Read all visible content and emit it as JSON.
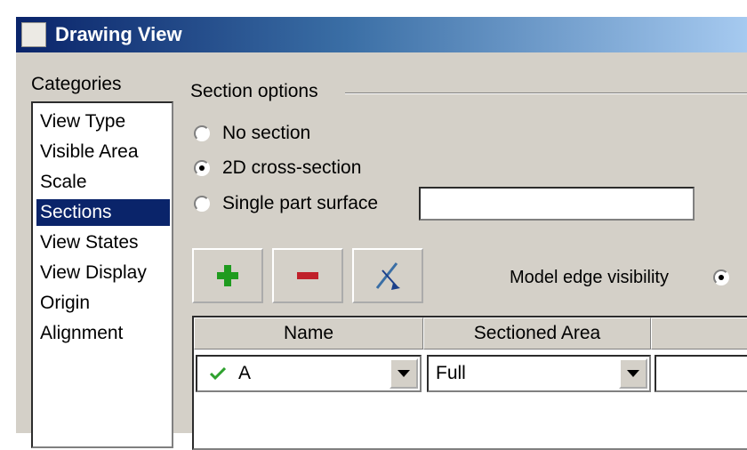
{
  "window": {
    "title": "Drawing View"
  },
  "categories": {
    "label": "Categories",
    "items": [
      {
        "label": "View Type"
      },
      {
        "label": "Visible Area"
      },
      {
        "label": "Scale"
      },
      {
        "label": "Sections",
        "selected": true
      },
      {
        "label": "View States"
      },
      {
        "label": "View Display"
      },
      {
        "label": "Origin"
      },
      {
        "label": "Alignment"
      }
    ]
  },
  "section_options": {
    "group_label": "Section options",
    "options": [
      {
        "label": "No section",
        "checked": false
      },
      {
        "label": "2D cross-section",
        "checked": true
      },
      {
        "label": "Single part surface",
        "checked": false
      }
    ],
    "single_part_value": ""
  },
  "toolbar": {
    "add_icon": "plus-icon",
    "remove_icon": "minus-icon",
    "flip_icon": "flip-arrow-icon"
  },
  "model_edge": {
    "label": "Model edge visibility",
    "checked": true
  },
  "table": {
    "columns": [
      "Name",
      "Sectioned Area",
      ""
    ],
    "rows": [
      {
        "status_icon": "checkmark-icon",
        "name": "A",
        "area": "Full",
        "extra": ""
      }
    ]
  },
  "colors": {
    "titlebar_start": "#0a246a",
    "titlebar_end": "#a6caf0",
    "selection": "#0a246a",
    "face": "#d4d0c8"
  }
}
